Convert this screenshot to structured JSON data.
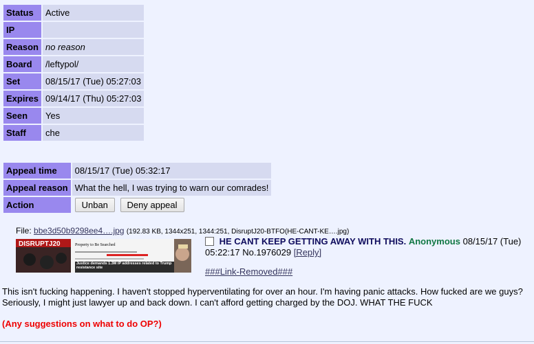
{
  "ban": {
    "rows": [
      {
        "label": "Status",
        "value": "Active"
      },
      {
        "label": "IP",
        "value": ""
      },
      {
        "label": "Reason",
        "value": "no reason"
      },
      {
        "label": "Board",
        "value": "/leftypol/"
      },
      {
        "label": "Set",
        "value": "08/15/17 (Tue) 05:27:03"
      },
      {
        "label": "Expires",
        "value": "09/14/17 (Thu) 05:27:03"
      },
      {
        "label": "Seen",
        "value": "Yes"
      },
      {
        "label": "Staff",
        "value": "che"
      }
    ]
  },
  "appeal": {
    "time_label": "Appeal time",
    "time_value": "08/15/17 (Tue) 05:32:17",
    "reason_label": "Appeal reason",
    "reason_value": "What the hell, I was trying to warn our comrades!",
    "action_label": "Action",
    "unban_label": "Unban",
    "deny_label": "Deny appeal"
  },
  "post": {
    "file_label": "File:",
    "file_name": "bbe3d50b9298ee4….jpg",
    "file_meta": "(192.83 KB, 1344x251, 1344:251, DisruptJ20-BTFO(HE-CANT-KE….jpg)",
    "thumb_text_1": "DISRUPTJ20",
    "thumb_text_2": "Property to Be Searched",
    "thumb_text_3": "Justice demands 1.3M IP addresses related to Trump resistance site",
    "subject": "HE CANT KEEP GETTING AWAY WITH THIS.",
    "name": "Anonymous",
    "date": "08/15/17 (Tue)",
    "time_no": "05:22:17 No.1976029",
    "reply_label": "[Reply]",
    "link_removed": "###Link-Removed###",
    "body": "This isn't fucking happening. I haven't stopped hyperventilating for over an hour. I'm having panic attacks. How fucked are we guys? Seriously, I might just lawyer up and back down. I can't afford getting charged by the DOJ. WHAT THE FUCK",
    "red_text": "(Any suggestions on what to do OP?)"
  }
}
